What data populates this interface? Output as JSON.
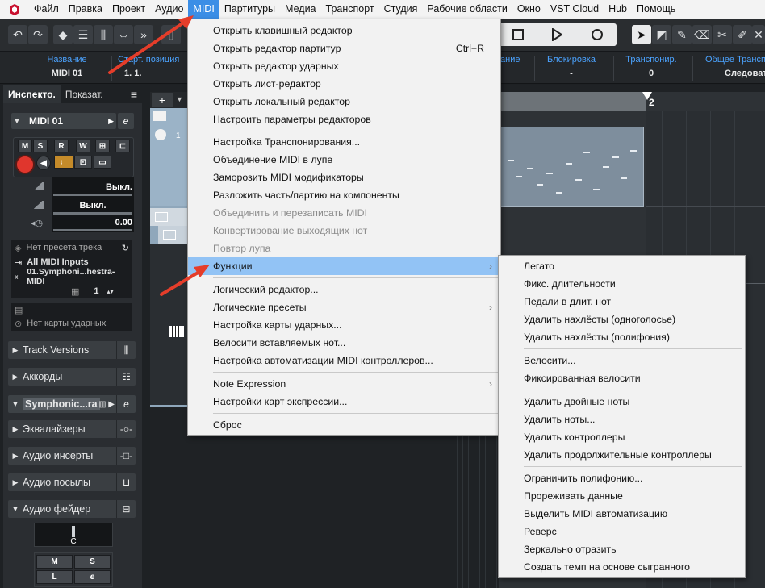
{
  "menubar": {
    "items": [
      "Файл",
      "Правка",
      "Проект",
      "Аудио",
      "MIDI",
      "Партитуры",
      "Медиа",
      "Транспорт",
      "Студия",
      "Рабочие области",
      "Окно",
      "VST Cloud",
      "Hub",
      "Помощь"
    ],
    "active": "MIDI"
  },
  "infoline": {
    "name_label": "Название",
    "name_value": "MIDI 01",
    "start_label": "Старт. позиция",
    "start_value": "1. 1.",
    "cut_label": "ание",
    "lock_label": "Блокировка",
    "lock_value": "-",
    "transpose_label": "Транспонир.",
    "transpose_value": "0",
    "global_label": "Общее Транспониров.",
    "global_value": "Следовать"
  },
  "inspector": {
    "tab_inspector": "Инспекто.",
    "tab_show": "Показат.",
    "tab_menu": "≡",
    "track_name": "MIDI 01",
    "btn_m": "M",
    "btn_s": "S",
    "btn_r": "R",
    "btn_w": "W",
    "vol_value": "Выкл.",
    "pan_value": "Выкл.",
    "delay_value": "0.00",
    "preset": "Нет пресета трека",
    "input": "All MIDI Inputs",
    "output": "01.Symphoni...hestra-MIDI",
    "channel": "1",
    "drum_map": "Нет карты ударных",
    "sections": {
      "track_versions": "Track Versions",
      "chords": "Аккорды",
      "instrument": "Symphonic...ra",
      "eq": "Эквалайзеры",
      "inserts": "Аудио инсерты",
      "sends": "Аудио посылы",
      "fader": "Аудио фейдер"
    },
    "fader_label": "C",
    "fader_m": "M",
    "fader_s": "S",
    "fader_l": "L",
    "fader_e": "e"
  },
  "ruler": {
    "bar_label": "2"
  },
  "track_number": "1",
  "midi_menu": {
    "items": [
      {
        "label": "Открыть клавишный редактор"
      },
      {
        "label": "Открыть редактор партитур",
        "shortcut": "Ctrl+R"
      },
      {
        "label": "Открыть редактор ударных"
      },
      {
        "label": "Открыть лист-редактор"
      },
      {
        "label": "Открыть локальный редактор"
      },
      {
        "label": "Настроить параметры редакторов"
      },
      {
        "label": "Настройка Транспонирования..."
      },
      {
        "label": "Объединение MIDI в лупе"
      },
      {
        "label": "Заморозить MIDI модификаторы"
      },
      {
        "label": "Разложить часть/партию на компоненты"
      },
      {
        "label": "Объединить и перезаписать MIDI"
      },
      {
        "label": "Конвертирование выходящих нот"
      },
      {
        "label": "Повтор лупа"
      },
      {
        "label": "Функции"
      },
      {
        "label": "Логический редактор..."
      },
      {
        "label": "Логические пресеты"
      },
      {
        "label": "Настройка карты ударных..."
      },
      {
        "label": "Велосити вставляемых нот..."
      },
      {
        "label": "Настройка автоматизации MIDI контроллеров..."
      },
      {
        "label": "Note Expression"
      },
      {
        "label": "Настройки карт экспрессии..."
      },
      {
        "label": "Сброс"
      }
    ]
  },
  "functions_submenu": {
    "items": [
      "Легато",
      "Фикс. длительности",
      "Педали в длит. нот",
      "Удалить нахлёсты (одноголосье)",
      "Удалить нахлёсты (полифония)",
      "Велосити...",
      "Фиксированная велосити",
      "Удалить двойные ноты",
      "Удалить ноты...",
      "Удалить контроллеры",
      "Удалить продолжительные контроллеры",
      "Ограничить полифонию...",
      "Прореживать данные",
      "Выделить MIDI автоматизацию",
      "Реверс",
      "Зеркально отразить",
      "Создать темп на основе сыгранного"
    ]
  },
  "colors": {
    "menu_highlight": "#92c3f5",
    "menubar_active": "#3b8ee6",
    "info_label": "#4ba3ff",
    "arrow": "#e53d2a",
    "record": "#e0362d"
  },
  "icons": [
    "undo-icon",
    "redo-icon",
    "stop-icon",
    "play-icon",
    "record-icon",
    "pointer-icon",
    "pencil-icon",
    "eraser-icon",
    "scissors-icon",
    "glue-icon"
  ]
}
